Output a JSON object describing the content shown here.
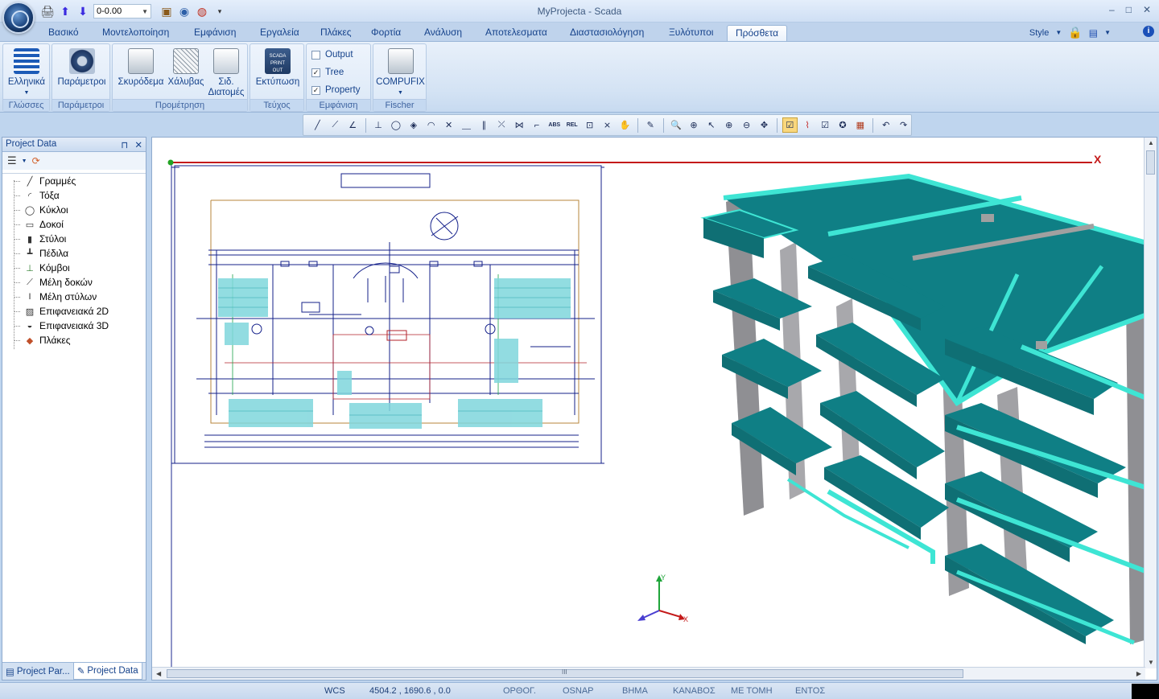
{
  "window": {
    "title": "MyProjecta - Scada",
    "minimize": "‒",
    "maximize": "□",
    "close": "✕"
  },
  "qat": {
    "combo_value": "0-0.00"
  },
  "tabs": [
    "Βασικό",
    "Μοντελοποίηση",
    "Εμφάνιση",
    "Εργαλεία",
    "Πλάκες",
    "Φορτία",
    "Ανάλυση",
    "Αποτελεσματα",
    "Διαστασιολόγηση",
    "Ξυλότυποι",
    "Πρόσθετα"
  ],
  "style_menu": {
    "label": "Style"
  },
  "ribbon": {
    "groups": {
      "languages": {
        "label": "Γλώσσες",
        "button": "Ελληνικά"
      },
      "params": {
        "label": "Παράμετροι",
        "button": "Παράμετροι"
      },
      "measure": {
        "label": "Προμέτρηση",
        "concrete": "Σκυρόδεμα",
        "steel": "Χάλυβας",
        "sections_1": "Σιδ.",
        "sections_2": "Διατομές"
      },
      "print": {
        "label": "Τεύχος",
        "button": "Εκτύπωση",
        "icon_text_1": "SCADA",
        "icon_text_2": "PRINT OUT"
      },
      "view": {
        "label": "Εμφάνιση",
        "output": "Output",
        "tree": "Tree",
        "property": "Property",
        "output_checked": false,
        "tree_checked": true,
        "property_checked": true
      },
      "fischer": {
        "label": "Fischer",
        "button": "COMPUFIX"
      }
    }
  },
  "toolbar": {
    "abs": "ABS",
    "rel": "REL"
  },
  "panel": {
    "title": "Project Data",
    "pin": "⊓",
    "close": "✕",
    "items": [
      "Γραμμές",
      "Τόξα",
      "Κύκλοι",
      "Δοκοί",
      "Στύλοι",
      "Πέδιλα",
      "Κόμβοι",
      "Μέλη δοκών",
      "Μέλη στύλων",
      "Επιφανειακά 2D",
      "Επιφανειακά 3D",
      "Πλάκες"
    ],
    "tab_1": "Project Par...",
    "tab_2": "Project Data"
  },
  "canvas": {
    "axis_x_label": "X",
    "gizmo_y": "Y",
    "gizmo_x": "X",
    "hscroll_grip": "III"
  },
  "status": {
    "wcs": "WCS",
    "coords": "4504.2 , 1690.6 , 0.0",
    "ortho": "ΟΡΘΟΓ.",
    "osnap": "OSNAP",
    "step": "ΒΗΜΑ",
    "canvas": "ΚΑΝΑΒΟΣ",
    "section": "ΜΕ ΤΟΜΗ",
    "entos": "ΕΝΤΟΣ"
  },
  "colors": {
    "slab": "#0f7f85",
    "slab_edge": "#3ee5d4",
    "column": "#9a9a9e",
    "drawing_blue": "#14208a"
  }
}
